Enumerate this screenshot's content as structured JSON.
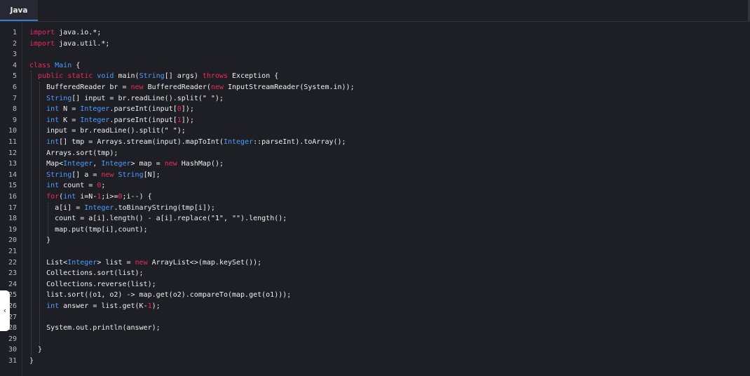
{
  "tabs": [
    {
      "label": "Java",
      "active": true
    }
  ],
  "colors": {
    "keyword": "#f2295c",
    "type": "#4f9dff",
    "number": "#f2295c",
    "text": "#f0f0f0",
    "background": "#1d1f25"
  },
  "collapse_handle": {
    "icon": "chevron-left-icon",
    "glyph": "‹"
  },
  "code": {
    "line_numbers": [
      "1",
      "2",
      "3",
      "4",
      "5",
      "6",
      "7",
      "8",
      "9",
      "10",
      "11",
      "12",
      "13",
      "14",
      "15",
      "16",
      "17",
      "18",
      "19",
      "20",
      "21",
      "22",
      "23",
      "24",
      "25",
      "26",
      "27",
      "28",
      "29",
      "30",
      "31"
    ],
    "lines": [
      [
        {
          "t": "import",
          "c": "kw"
        },
        {
          "t": " java.io.*;"
        }
      ],
      [
        {
          "t": "import",
          "c": "kw"
        },
        {
          "t": " java.util.*;"
        }
      ],
      [],
      [
        {
          "t": "class",
          "c": "kw"
        },
        {
          "t": " "
        },
        {
          "t": "Main",
          "c": "ty"
        },
        {
          "t": " {"
        }
      ],
      [
        {
          "t": "  "
        },
        {
          "t": "public",
          "c": "kw"
        },
        {
          "t": " "
        },
        {
          "t": "static",
          "c": "kw"
        },
        {
          "t": " "
        },
        {
          "t": "void",
          "c": "ty"
        },
        {
          "t": " main("
        },
        {
          "t": "String",
          "c": "ty"
        },
        {
          "t": "[] args) "
        },
        {
          "t": "throws",
          "c": "kw"
        },
        {
          "t": " Exception {"
        }
      ],
      [
        {
          "t": "    BufferedReader br = "
        },
        {
          "t": "new",
          "c": "kw"
        },
        {
          "t": " BufferedReader("
        },
        {
          "t": "new",
          "c": "kw"
        },
        {
          "t": " InputStreamReader(System.in));"
        }
      ],
      [
        {
          "t": "    "
        },
        {
          "t": "String",
          "c": "ty"
        },
        {
          "t": "[] input = br.readLine().split("
        },
        {
          "t": "\" \"",
          "c": "st"
        },
        {
          "t": ");"
        }
      ],
      [
        {
          "t": "    "
        },
        {
          "t": "int",
          "c": "ty"
        },
        {
          "t": " N = "
        },
        {
          "t": "Integer",
          "c": "ty"
        },
        {
          "t": ".parseInt(input["
        },
        {
          "t": "0",
          "c": "nm"
        },
        {
          "t": "]);"
        }
      ],
      [
        {
          "t": "    "
        },
        {
          "t": "int",
          "c": "ty"
        },
        {
          "t": " K = "
        },
        {
          "t": "Integer",
          "c": "ty"
        },
        {
          "t": ".parseInt(input["
        },
        {
          "t": "1",
          "c": "nm"
        },
        {
          "t": "]);"
        }
      ],
      [
        {
          "t": "    input = br.readLine().split("
        },
        {
          "t": "\" \"",
          "c": "st"
        },
        {
          "t": ");"
        }
      ],
      [
        {
          "t": "    "
        },
        {
          "t": "int",
          "c": "ty"
        },
        {
          "t": "[] tmp = Arrays.stream(input).mapToInt("
        },
        {
          "t": "Integer",
          "c": "ty"
        },
        {
          "t": "::parseInt).toArray();"
        }
      ],
      [
        {
          "t": "    Arrays.sort(tmp);"
        }
      ],
      [
        {
          "t": "    Map<"
        },
        {
          "t": "Integer",
          "c": "ty"
        },
        {
          "t": ", "
        },
        {
          "t": "Integer",
          "c": "ty"
        },
        {
          "t": "> map = "
        },
        {
          "t": "new",
          "c": "kw"
        },
        {
          "t": " HashMap();"
        }
      ],
      [
        {
          "t": "    "
        },
        {
          "t": "String",
          "c": "ty"
        },
        {
          "t": "[] a = "
        },
        {
          "t": "new",
          "c": "kw"
        },
        {
          "t": " "
        },
        {
          "t": "String",
          "c": "ty"
        },
        {
          "t": "[N];"
        }
      ],
      [
        {
          "t": "    "
        },
        {
          "t": "int",
          "c": "ty"
        },
        {
          "t": " count = "
        },
        {
          "t": "0",
          "c": "nm"
        },
        {
          "t": ";"
        }
      ],
      [
        {
          "t": "    "
        },
        {
          "t": "for",
          "c": "kw"
        },
        {
          "t": "("
        },
        {
          "t": "int",
          "c": "ty"
        },
        {
          "t": " i=N-"
        },
        {
          "t": "1",
          "c": "nm"
        },
        {
          "t": ";i>="
        },
        {
          "t": "0",
          "c": "nm"
        },
        {
          "t": ";i--) {"
        }
      ],
      [
        {
          "t": "      a[i] = "
        },
        {
          "t": "Integer",
          "c": "ty"
        },
        {
          "t": ".toBinaryString(tmp[i]);"
        }
      ],
      [
        {
          "t": "      count = a[i].length() - a[i].replace("
        },
        {
          "t": "\"1\"",
          "c": "st"
        },
        {
          "t": ", "
        },
        {
          "t": "\"\"",
          "c": "st"
        },
        {
          "t": ").length();"
        }
      ],
      [
        {
          "t": "      map.put(tmp[i],count);"
        }
      ],
      [
        {
          "t": "    }"
        }
      ],
      [],
      [
        {
          "t": "    List<"
        },
        {
          "t": "Integer",
          "c": "ty"
        },
        {
          "t": "> list = "
        },
        {
          "t": "new",
          "c": "kw"
        },
        {
          "t": " ArrayList<>(map.keySet());"
        }
      ],
      [
        {
          "t": "    Collections.sort(list);"
        }
      ],
      [
        {
          "t": "    Collections.reverse(list);"
        }
      ],
      [
        {
          "t": "    list.sort((o1, o2) -> map.get(o2).compareTo(map.get(o1)));"
        }
      ],
      [
        {
          "t": "    "
        },
        {
          "t": "int",
          "c": "ty"
        },
        {
          "t": " answer = list.get(K-"
        },
        {
          "t": "1",
          "c": "nm"
        },
        {
          "t": ");"
        }
      ],
      [],
      [
        {
          "t": "    System.out.println(answer);"
        }
      ],
      [],
      [
        {
          "t": "  }"
        }
      ],
      [
        {
          "t": "}"
        }
      ]
    ]
  }
}
